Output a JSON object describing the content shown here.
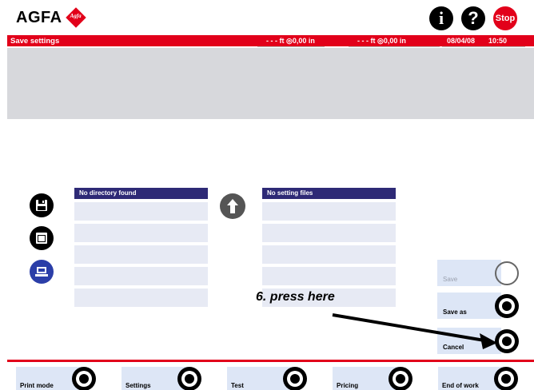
{
  "logo": {
    "text": "AGFA",
    "badge_text": "Agfa"
  },
  "header": {
    "info_icon": "info-icon",
    "help_icon": "help-icon",
    "stop_label": "Stop"
  },
  "status_bar": {
    "title": "Save settings",
    "counter1": "- - - ft ◎0,00 in",
    "counter2": "- - - ft ◎0,00 in",
    "date": "08/04/08",
    "time": "10:50"
  },
  "side_icons": [
    "floppy-save-icon",
    "save-device-icon",
    "computer-icon"
  ],
  "directory_panel": {
    "header": "No directory found",
    "rows": 5
  },
  "settings_panel": {
    "header": "No setting files",
    "rows": 5
  },
  "up_icon": "arrow-up-icon",
  "actions": {
    "save": "Save",
    "save_as": "Save as",
    "cancel": "Cancel"
  },
  "annotation": "6. press here",
  "bottom_nav": [
    {
      "label": "Print mode"
    },
    {
      "label": "Settings"
    },
    {
      "label": "Test"
    },
    {
      "label": "Pricing"
    },
    {
      "label": "End of work"
    }
  ],
  "colors": {
    "accent_red": "#e2001a",
    "panel_header": "#2e2a76",
    "panel_row": "#e7eaf4",
    "button_pad": "#dde6f6",
    "gray_band": "#d7d8dc"
  }
}
